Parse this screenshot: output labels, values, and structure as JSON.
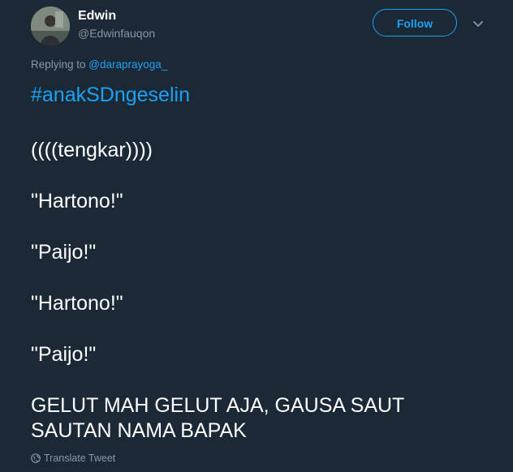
{
  "author": {
    "display_name": "Edwin",
    "username": "@Edwinfauqon"
  },
  "actions": {
    "follow_label": "Follow",
    "menu_icon": "chevron-down-icon"
  },
  "reply": {
    "prefix": "Replying to ",
    "mention": "@daraprayoga_"
  },
  "tweet": {
    "hashtag": "#anakSDngeselin",
    "lines": [
      "((((tengkar))))",
      "\"Hartono!\"",
      "\"Paijo!\"",
      "\"Hartono!\"",
      "\"Paijo!\"",
      "GELUT MAH GELUT AJA, GAUSA SAUT",
      "SAUTAN NAMA BAPAK"
    ]
  },
  "footer": {
    "translate_label": "Translate Tweet",
    "translate_icon": "globe-icon"
  },
  "colors": {
    "background": "#1b2836",
    "accent": "#1da1f2",
    "secondary_text": "#8899a6",
    "primary_text": "#ffffff"
  }
}
